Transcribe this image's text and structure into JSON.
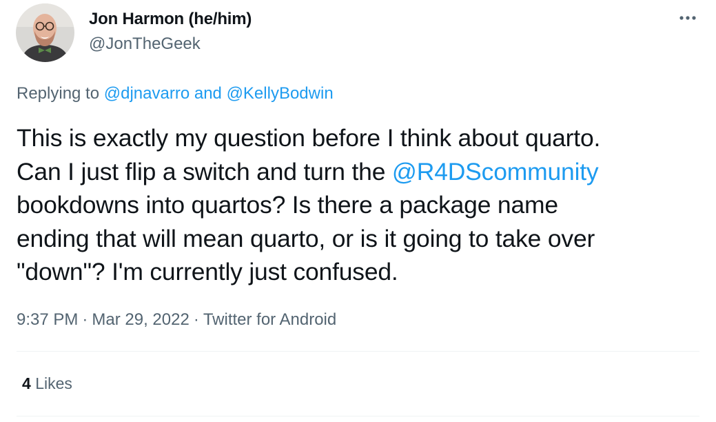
{
  "author": {
    "name": "Jon Harmon (he/him)",
    "handle": "@JonTheGeek",
    "avatar_icon": "profile-photo"
  },
  "more_icon": "ellipsis-icon",
  "reply_context": {
    "prefix": "Replying to",
    "user1": "@djnavarro",
    "conjunction": "and",
    "user2": "@KellyBodwin"
  },
  "tweet": {
    "line1": "This is exactly my question before I think about quarto.",
    "line2_before": "Can I just flip a switch and turn the",
    "line2_mention": "@R4DScommunity",
    "line3": "bookdowns into quartos? Is there a package name",
    "line4": "ending that will mean quarto, or is it going to take over",
    "line5": "\"down\"? I'm currently just confused."
  },
  "meta": {
    "time": "9:37 PM",
    "separator": "·",
    "date": "Mar 29, 2022",
    "source": "Twitter for Android"
  },
  "engagement": {
    "likes_count": "4",
    "likes_label": "Likes"
  },
  "colors": {
    "link": "#1d9bf0",
    "secondary_text": "#536471",
    "primary_text": "#0f1419",
    "divider": "#eff3f4"
  }
}
